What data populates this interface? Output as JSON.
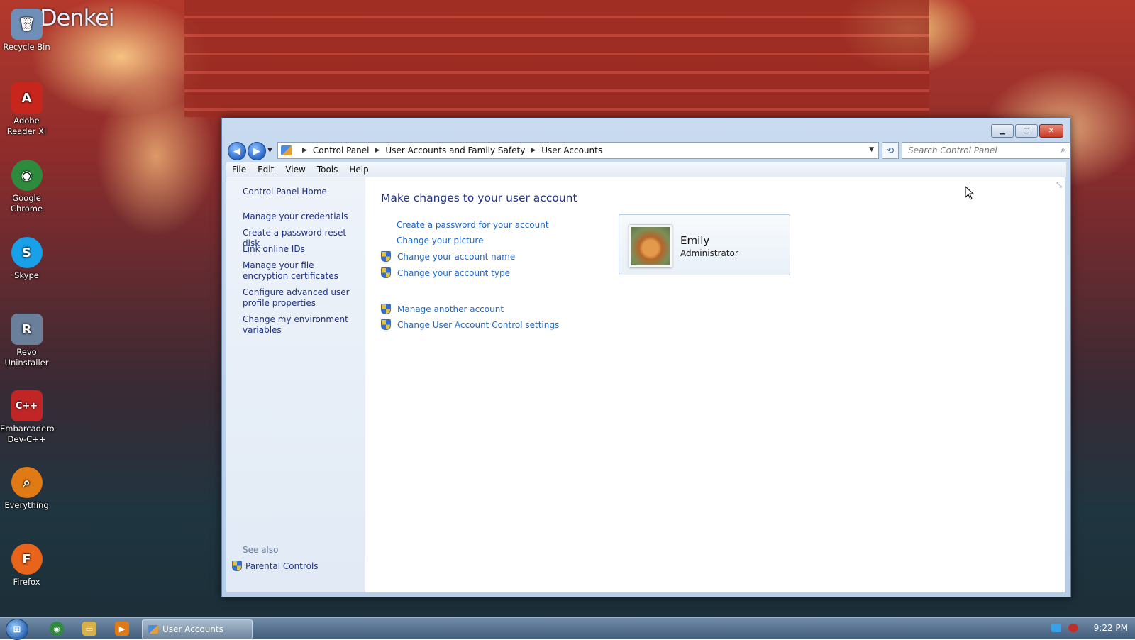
{
  "desktop": {
    "brand_text": "Denkei",
    "icons": [
      {
        "label": "Recycle Bin",
        "color": "#6f8fb8",
        "glyph": "🗑"
      },
      {
        "label": "Adobe Reader XI",
        "color": "#c8261d",
        "glyph": "A"
      },
      {
        "label": "Google Chrome",
        "color": "#2e8b3d",
        "glyph": "◉"
      },
      {
        "label": "Skype",
        "color": "#1aa0e8",
        "glyph": "S"
      },
      {
        "label": "Revo Uninstaller",
        "color": "#6a7f9a",
        "glyph": "R"
      },
      {
        "label": "Embarcadero Dev-C++",
        "color": "#c02626",
        "glyph": "C++"
      },
      {
        "label": "Everything",
        "color": "#e07a14",
        "glyph": "⌕"
      },
      {
        "label": "Firefox",
        "color": "#e8641a",
        "glyph": "F"
      }
    ]
  },
  "window": {
    "breadcrumb": [
      "Control Panel",
      "User Accounts and Family Safety",
      "User Accounts"
    ],
    "search_placeholder": "Search Control Panel",
    "menu": [
      "File",
      "Edit",
      "View",
      "Tools",
      "Help"
    ]
  },
  "left_pane": {
    "home": "Control Panel Home",
    "links": [
      "Manage your credentials",
      "Create a password reset disk",
      "Link online IDs",
      "Manage your file encryption certificates",
      "Configure advanced user profile properties",
      "Change my environment variables"
    ],
    "see_also_label": "See also",
    "see_also_links": [
      "Parental Controls"
    ]
  },
  "main": {
    "title": "Make changes to your user account",
    "actions": [
      {
        "label": "Create a password for your account",
        "shield": false
      },
      {
        "label": "Change your picture",
        "shield": false
      },
      {
        "label": "Change your account name",
        "shield": true
      },
      {
        "label": "Change your account type",
        "shield": true
      }
    ],
    "secondary_actions": [
      {
        "label": "Manage another account",
        "shield": true
      },
      {
        "label": "Change User Account Control settings",
        "shield": true
      }
    ],
    "user": {
      "name": "Emily",
      "role": "Administrator"
    }
  },
  "taskbar": {
    "task_label": "User Accounts",
    "clock": "9:22 PM"
  },
  "colors": {
    "link": "#1e68c8",
    "heading": "#1e3287"
  }
}
